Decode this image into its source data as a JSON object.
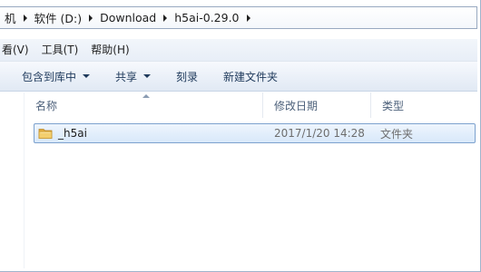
{
  "address_bar": {
    "crumbs": [
      "机",
      "软件 (D:)",
      "Download",
      "h5ai-0.29.0"
    ],
    "separator_icon": "chevron-right-icon"
  },
  "menu": {
    "items": [
      "看(V)",
      "工具(T)",
      "帮助(H)"
    ]
  },
  "toolbar": {
    "include_in_library": "包含到库中",
    "share": "共享",
    "burn": "刻录",
    "new_folder": "新建文件夹"
  },
  "columns": {
    "name": "名称",
    "date_modified": "修改日期",
    "type": "类型",
    "sort_icon": "sort-ascending-icon"
  },
  "files": [
    {
      "icon": "folder-icon",
      "name": "_h5ai",
      "date_modified": "2017/1/20 14:28",
      "type": "文件夹",
      "selected": true
    }
  ],
  "colors": {
    "selection_border": "#7da2ce",
    "selection_fill": "#d8e8fa",
    "toolbar_text": "#1e395b",
    "folder": "#e8b64a"
  }
}
